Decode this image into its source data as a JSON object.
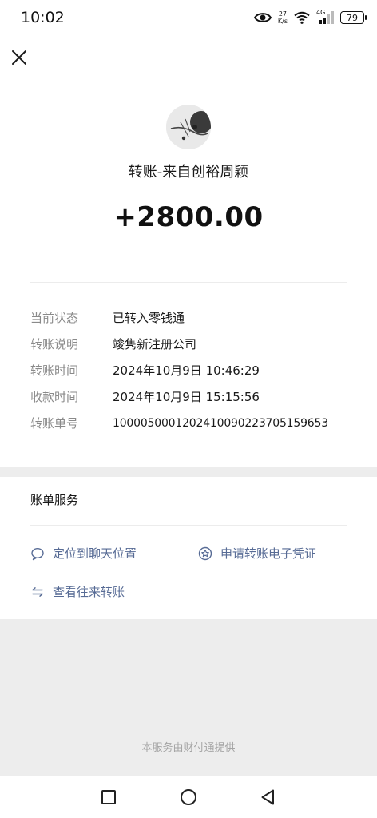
{
  "status_bar": {
    "time": "10:02",
    "net_speed_value": "27",
    "net_speed_unit": "K/s",
    "network_type": "4G",
    "battery": "79",
    "icons": [
      "eye-icon",
      "wifi-icon",
      "signal-icon",
      "battery-icon"
    ]
  },
  "header": {
    "close_icon": "close-icon"
  },
  "transfer": {
    "title": "转账-来自创裕周颖",
    "amount": "+2800.00"
  },
  "details": [
    {
      "label": "当前状态",
      "value": "已转入零钱通"
    },
    {
      "label": "转账说明",
      "value": "竣隽新注册公司"
    },
    {
      "label": "转账时间",
      "value": "2024年10月9日 10:46:29"
    },
    {
      "label": "收款时间",
      "value": "2024年10月9日 15:15:56"
    },
    {
      "label": "转账单号",
      "value": "1000050001202410090223705159653"
    }
  ],
  "services": {
    "title": "账单服务",
    "locate_chat": "定位到聊天位置",
    "apply_voucher": "申请转账电子凭证",
    "view_history": "查看往来转账"
  },
  "footer": {
    "provider_text": "本服务由财付通提供"
  },
  "colors": {
    "link": "#576b95",
    "background": "#ededed",
    "card": "#ffffff",
    "label": "#8a8a8a"
  }
}
